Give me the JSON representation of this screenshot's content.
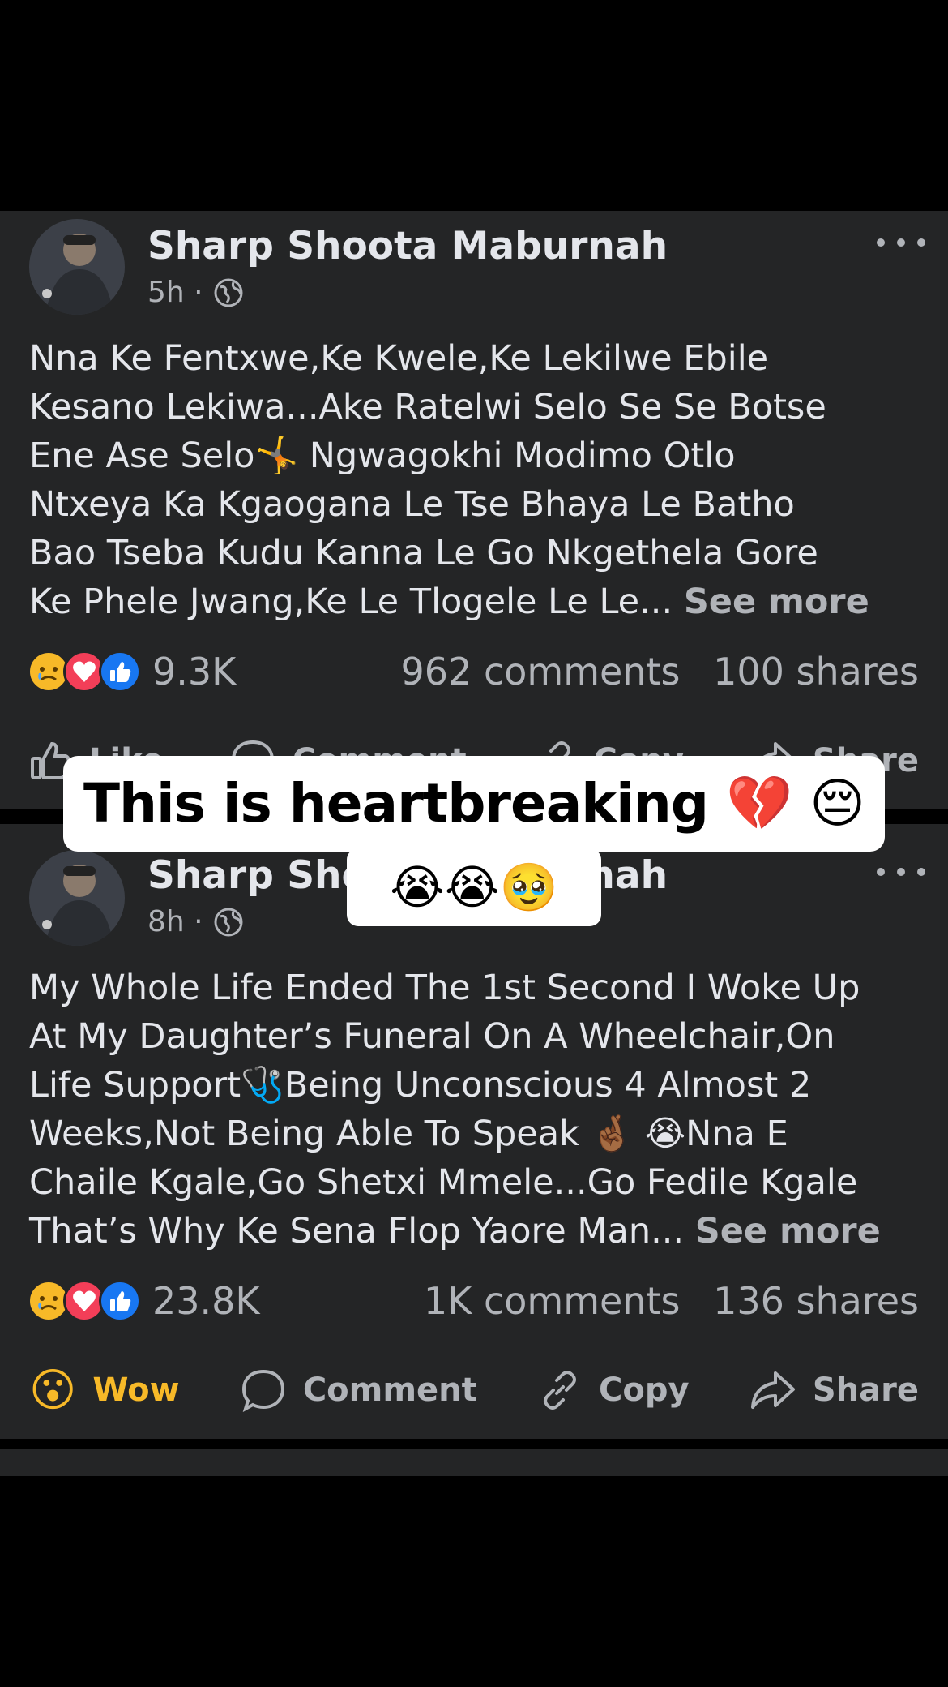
{
  "overlay": {
    "line1": "This is heartbreaking 💔 😔",
    "line2": "😭😭🥹"
  },
  "posts": [
    {
      "author": "Sharp Shoota Maburnah",
      "time": "5h ·",
      "body_lines": [
        "Nna Ke Fentxwe,Ke Kwele,Ke Lekilwe Ebile",
        "Kesano Lekiwa...Ake Ratelwi Selo Se Se Botse",
        "Ene Ase Selo🤸 Ngwagokhi Modimo Otlo",
        "Ntxeya Ka Kgaogana Le Tse Bhaya Le Batho",
        "Bao Tseba Kudu Kanna Le Go Nkgethela Gore",
        "Ke Phele Jwang,Ke Le Tlogele Le Le..."
      ],
      "see_more": "See more",
      "reactions_count": "9.3K",
      "comments": "962 comments",
      "shares": "100 shares",
      "actions": [
        "Like",
        "Comment",
        "Copy",
        "Share"
      ]
    },
    {
      "author": "Sharp Shoota Maburnah",
      "time": "8h ·",
      "body_lines": [
        "My Whole Life Ended The 1st Second I Woke Up",
        "At My Daughter’s Funeral On A Wheelchair,On",
        "Life Support🩺Being Unconscious 4 Almost 2",
        "Weeks,Not Being Able To Speak 🤞🏾 😭Nna E",
        "Chaile Kgale,Go Shetxi Mmele...Go Fedile Kgale",
        "That’s Why Ke Sena Flop Yaore Man..."
      ],
      "see_more": "See more",
      "reactions_count": "23.8K",
      "comments": "1K comments",
      "shares": "136 shares",
      "actions": [
        "Wow",
        "Comment",
        "Copy",
        "Share"
      ],
      "wow_emoji": "😮"
    }
  ],
  "icons": {
    "reactions": [
      "sad-icon",
      "love-icon",
      "like-icon"
    ],
    "privacy": "globe-icon",
    "more": "more-dots-icon"
  },
  "colors": {
    "post_background": "#242526",
    "secondary_text": "#b0b3b8",
    "wow_label": "#f7b928",
    "like_blue": "#1877f2",
    "love_red": "#f33e58"
  }
}
